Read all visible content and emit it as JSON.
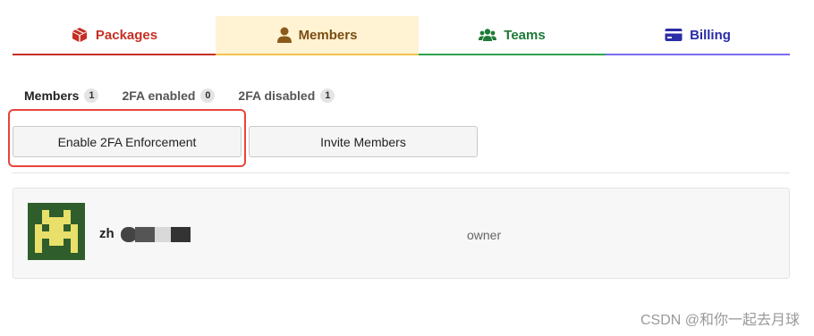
{
  "tabs": [
    {
      "label": "Packages",
      "icon": "package-icon",
      "color": "#c62f24"
    },
    {
      "label": "Members",
      "icon": "user-icon",
      "color": "#7a4e12",
      "active": true
    },
    {
      "label": "Teams",
      "icon": "users-icon",
      "color": "#1e7a37"
    },
    {
      "label": "Billing",
      "icon": "credit-card-icon",
      "color": "#2a2ca8"
    }
  ],
  "subtabs": [
    {
      "label": "Members",
      "count": "1",
      "active": true
    },
    {
      "label": "2FA enabled",
      "count": "0"
    },
    {
      "label": "2FA disabled",
      "count": "1"
    }
  ],
  "actions": {
    "enable_2fa_label": "Enable 2FA Enforcement",
    "invite_label": "Invite Members"
  },
  "members": [
    {
      "username_visible": "zh",
      "role": "owner",
      "avatar": "pixel-invader-avatar"
    }
  ],
  "watermark": "CSDN @和你一起去月球"
}
